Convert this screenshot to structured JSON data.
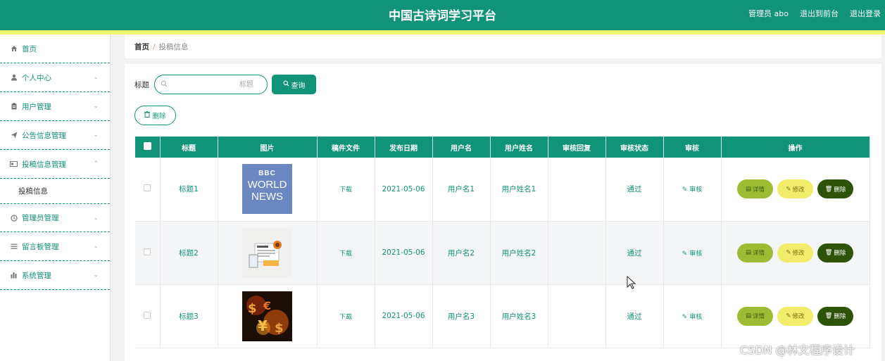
{
  "header": {
    "title": "中国古诗词学习平台",
    "admin_label": "管理员 abo",
    "back_front_label": "退出到前台",
    "logout_label": "退出登录",
    "colors": {
      "primary": "#119378",
      "stripe": "#f4f56e"
    }
  },
  "sidebar": {
    "items": [
      {
        "label": "首页",
        "icon": "home-icon"
      },
      {
        "label": "个人中心",
        "icon": "user-icon"
      },
      {
        "label": "用户管理",
        "icon": "clipboard-icon"
      },
      {
        "label": "公告信息管理",
        "icon": "send-icon"
      },
      {
        "label": "投稿信息管理",
        "icon": "card-icon"
      },
      {
        "label": "管理员管理",
        "icon": "clock-icon"
      },
      {
        "label": "留言板管理",
        "icon": "list-icon"
      },
      {
        "label": "系统管理",
        "icon": "chart-icon"
      }
    ],
    "subitem": {
      "label": "投稿信息"
    }
  },
  "breadcrumb": {
    "home": "首页",
    "separator": "/",
    "current": "投稿信息"
  },
  "search": {
    "label": "标题",
    "placeholder": "标题",
    "button_label": "查询"
  },
  "toolbar": {
    "delete_label": "删除"
  },
  "table": {
    "columns": [
      "标题",
      "图片",
      "稿件文件",
      "发布日期",
      "用户名",
      "用户姓名",
      "审核回复",
      "审核状态",
      "审核",
      "操作"
    ],
    "rows": [
      {
        "title": "标题1",
        "image": "bbc-world-news",
        "file": "下载",
        "date": "2021-05-06",
        "username": "用户名1",
        "realname": "用户姓名1",
        "reply": "",
        "status": "通过",
        "audit": "审核"
      },
      {
        "title": "标题2",
        "image": "news-illustration",
        "file": "下载",
        "date": "2021-05-06",
        "username": "用户名2",
        "realname": "用户姓名2",
        "reply": "",
        "status": "通过",
        "audit": "审核"
      },
      {
        "title": "标题3",
        "image": "currency-symbols-fire",
        "file": "下载",
        "date": "2021-05-06",
        "username": "用户名3",
        "realname": "用户姓名3",
        "reply": "",
        "status": "通过",
        "audit": "审核"
      }
    ],
    "actions": {
      "detail": "详情",
      "edit": "修改",
      "delete": "删除"
    }
  },
  "thumbnail_text": {
    "bbc_logo": "BBC",
    "world": "WORLD",
    "news": "NEWS"
  },
  "watermark": "CSDN @林文程序设计"
}
